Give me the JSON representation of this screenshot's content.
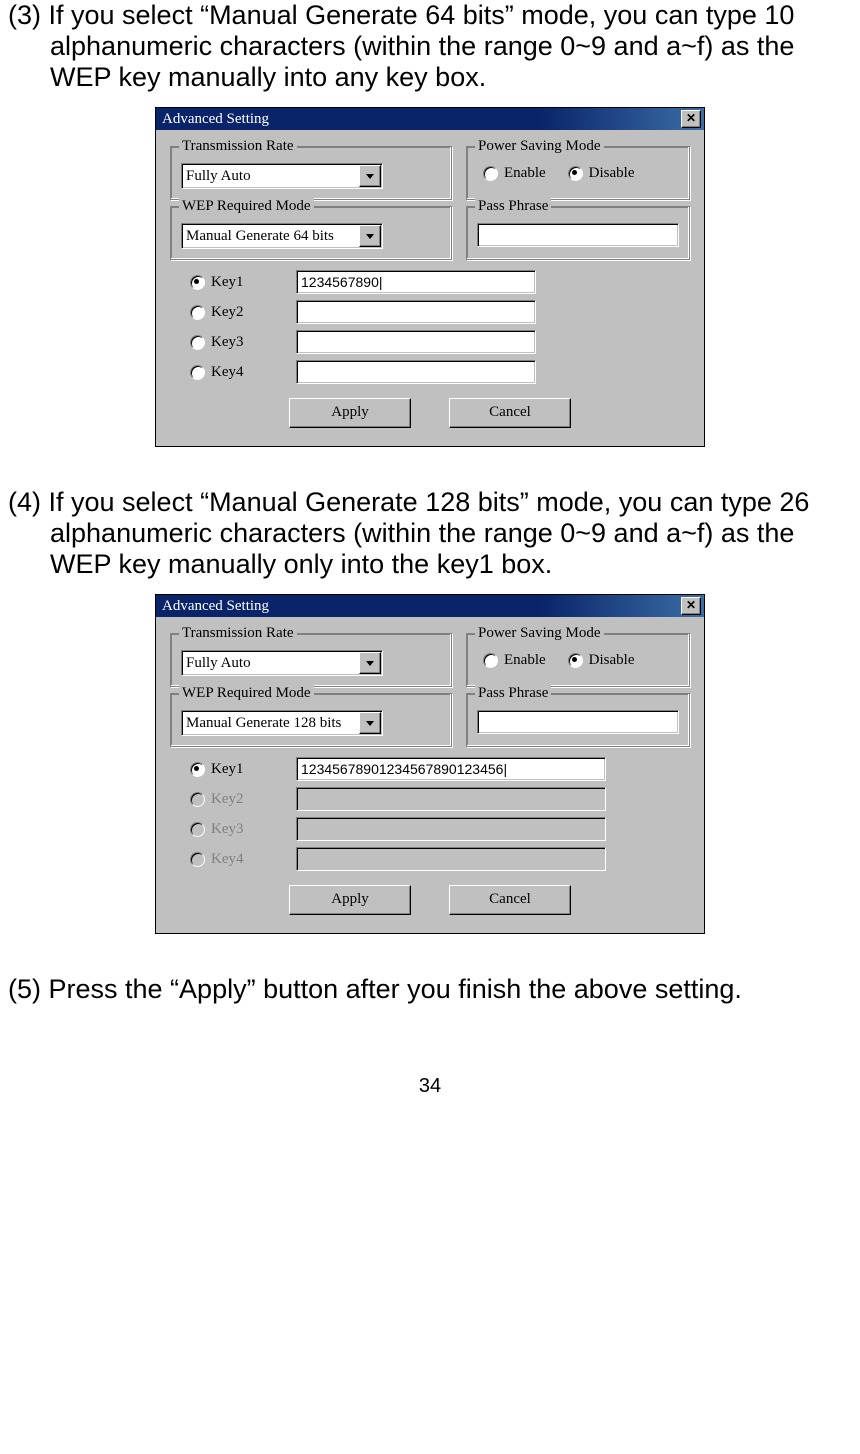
{
  "text": {
    "p3": "(3) If you select “Manual Generate 64 bits” mode, you can type 10 alphanumeric characters (within the range 0~9 and a~f) as the WEP key manually into any key box.",
    "p4": "(4) If you select “Manual Generate 128 bits” mode, you can type 26 alphanumeric characters (within the range 0~9 and a~f) as the WEP key manually only into the key1 box.",
    "p5": "(5) Press the “Apply” button after you finish the above setting.",
    "page_number": "34"
  },
  "dialog_common": {
    "title": "Advanced Setting",
    "close": "✕",
    "group_trans": "Transmission Rate",
    "group_power": "Power Saving Mode",
    "group_wep": "WEP Required Mode",
    "group_pass": "Pass Phrase",
    "trans_value": "Fully Auto",
    "enable": "Enable",
    "disable": "Disable",
    "key1": "Key1",
    "key2": "Key2",
    "key3": "Key3",
    "key4": "Key4",
    "btn_apply": "Apply",
    "btn_cancel": "Cancel"
  },
  "dialog_a": {
    "wep_value": "Manual Generate 64 bits",
    "key1_val": "1234567890|",
    "key2_val": "",
    "key3_val": "",
    "key4_val": "",
    "keys_disabled": false
  },
  "dialog_b": {
    "wep_value": "Manual Generate 128 bits",
    "key1_val": "12345678901234567890123456|",
    "key2_val": "",
    "key3_val": "",
    "key4_val": "",
    "keys_disabled": true
  }
}
